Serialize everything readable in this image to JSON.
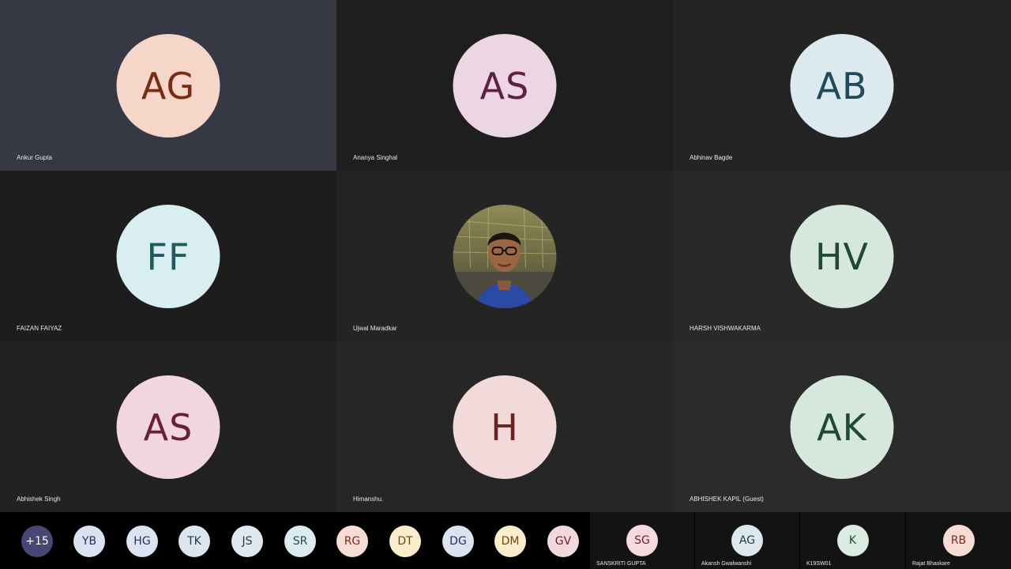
{
  "participants": [
    {
      "initials": "AG",
      "name": "Ankur Gupta",
      "bg": "#f5d6c8",
      "fg": "#7a2c12"
    },
    {
      "initials": "AS",
      "name": "Ananya Singhal",
      "bg": "#ecd6e3",
      "fg": "#5c2146"
    },
    {
      "initials": "AB",
      "name": "Abhinav Bagde",
      "bg": "#dce9ee",
      "fg": "#1f4a5a"
    },
    {
      "initials": "FF",
      "name": "FAIZAN FAIYAZ",
      "bg": "#d8eef0",
      "fg": "#1f5a5f"
    },
    {
      "initials": "",
      "name": "Ujwal Maradkar",
      "bg": "#6a6a4a",
      "fg": "#ffffff"
    },
    {
      "initials": "HV",
      "name": "HARSH VISHWAKARMA",
      "bg": "#d6e8de",
      "fg": "#1f4a32"
    },
    {
      "initials": "AS",
      "name": "Abhishek Singh",
      "bg": "#f2d6df",
      "fg": "#6a1f36"
    },
    {
      "initials": "H",
      "name": "Himanshu.",
      "bg": "#f2dada",
      "fg": "#6a2222"
    },
    {
      "initials": "AK",
      "name": "ABHISHEK KAPIL (Guest)",
      "bg": "#d6e8de",
      "fg": "#1f4a32"
    }
  ],
  "overflow": {
    "more": {
      "label": "+15",
      "bg": "#464775",
      "fg": "#ffffff"
    },
    "chips": [
      {
        "initials": "YB",
        "bg": "#dbe2f2",
        "fg": "#25315e"
      },
      {
        "initials": "HG",
        "bg": "#dbe2f2",
        "fg": "#25315e"
      },
      {
        "initials": "TK",
        "bg": "#dbe6ee",
        "fg": "#1f3a52"
      },
      {
        "initials": "JS",
        "bg": "#dfe8ee",
        "fg": "#1f3a4a"
      },
      {
        "initials": "SR",
        "bg": "#dcecee",
        "fg": "#1f4a52"
      },
      {
        "initials": "RG",
        "bg": "#f7ddd6",
        "fg": "#7a2c1a"
      },
      {
        "initials": "DT",
        "bg": "#fbeccb",
        "fg": "#6a4a10"
      },
      {
        "initials": "DG",
        "bg": "#dbe3f0",
        "fg": "#25315e"
      },
      {
        "initials": "DM",
        "bg": "#fbeccb",
        "fg": "#6a4a10"
      },
      {
        "initials": "GV",
        "bg": "#efd9dd",
        "fg": "#6a1f2a"
      }
    ]
  },
  "mini_tiles": [
    {
      "initials": "SG",
      "name": "SANSKRITI GUPTA",
      "bg": "#f7d9e0",
      "fg": "#6a1f30"
    },
    {
      "initials": "AG",
      "name": "Akansh Gwalwanshi",
      "bg": "#dde8ee",
      "fg": "#1f3a4a"
    },
    {
      "initials": "K",
      "name": "K19SW01",
      "bg": "#d9ece2",
      "fg": "#1f4a32"
    },
    {
      "initials": "RB",
      "name": "Rajat Bhaskare",
      "bg": "#f7dcd5",
      "fg": "#7a2c1a"
    }
  ]
}
